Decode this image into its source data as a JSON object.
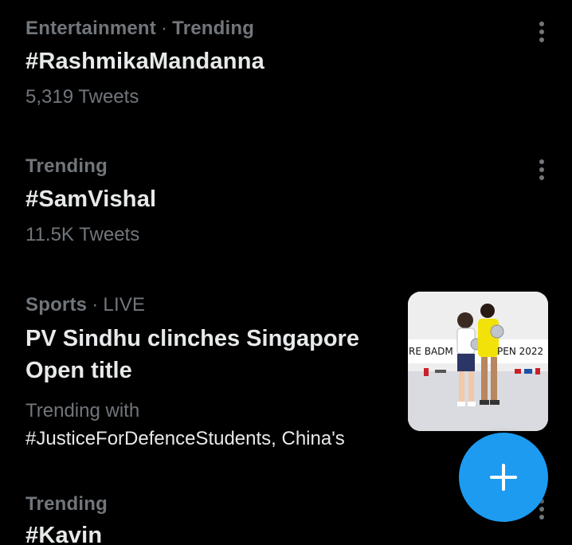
{
  "trends": [
    {
      "category": "Entertainment",
      "status": "Trending",
      "title": "#RashmikaMandanna",
      "count": "5,319 Tweets"
    },
    {
      "category": "Trending",
      "title": "#SamVishal",
      "count": "11.5K Tweets"
    },
    {
      "category": "Sports",
      "status": "LIVE",
      "headline": "PV Sindhu clinches Singapore Open title",
      "with_label": "Trending with",
      "with_tags": "#JusticeForDefenceStudents, China's",
      "thumbnail": {
        "banner_left": "RE BADM",
        "banner_right": "PEN 2022"
      }
    },
    {
      "category": "Trending",
      "title": "#Kavin"
    }
  ],
  "separator": "·",
  "icons": {
    "more": "more-vertical-icon",
    "compose": "plus-icon"
  },
  "colors": {
    "background": "#000000",
    "primary_text": "#e7e9ea",
    "secondary_text": "#71767b",
    "accent": "#1d9bf0"
  }
}
